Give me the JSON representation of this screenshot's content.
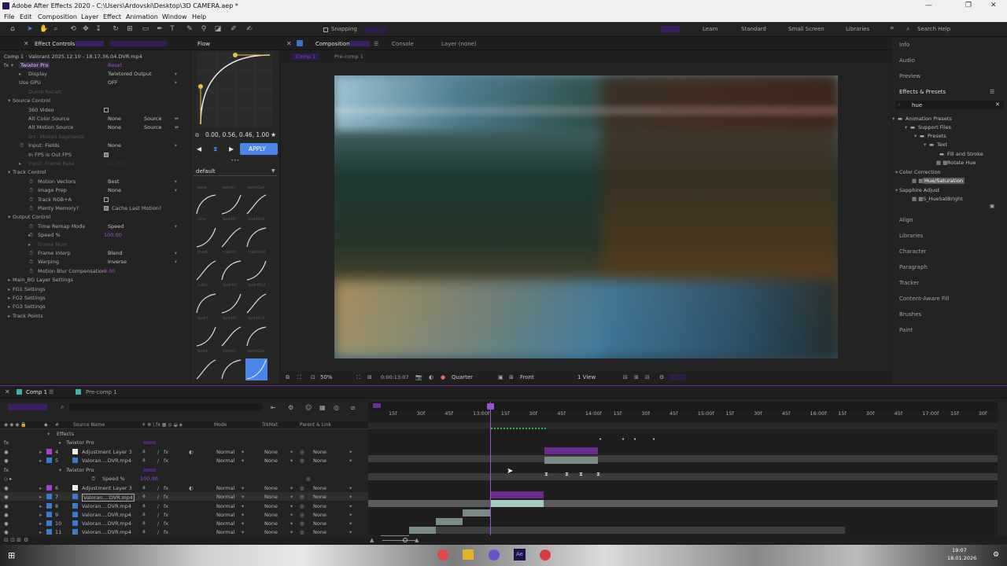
{
  "window": {
    "title": "Adobe After Effects 2020 - C:\\Users\\Ardovski\\Desktop\\3D CAMERA.aep *"
  },
  "menu": [
    "File",
    "Edit",
    "Composition",
    "Layer",
    "Effect",
    "Animation",
    "Window",
    "Help"
  ],
  "toolbar": {
    "snapping": "Snapping",
    "workspaces": [
      "Learn",
      "Standard",
      "Small Screen",
      "Libraries"
    ],
    "search_placeholder": "Search Help"
  },
  "effect_controls": {
    "tab": "Effect Controls",
    "layer": "Comp 1 · Valorant 2025.12.10 - 18.17.36.04.DVR.mp4",
    "plugin": "Twixtor Pro",
    "plugin_sub": "Reset",
    "rows": [
      {
        "label": "Display",
        "value": "Twixtored Output"
      },
      {
        "label": "Use GPU",
        "value": "OFF"
      },
      {
        "label": "Dumb Recalc",
        "value": ""
      },
      {
        "label": "Source Control",
        "value": ""
      },
      {
        "label": "360 Video",
        "value": ""
      },
      {
        "label": "Alt Color Source",
        "value": "None",
        "value2": "Source"
      },
      {
        "label": "Alt Motion Source",
        "value": "None",
        "value2": "Source"
      },
      {
        "label": "Src: Motion Segments",
        "value": ""
      },
      {
        "label": "Input: Fields",
        "value": "None"
      },
      {
        "label": "In FPS is Out FPS",
        "value": ""
      },
      {
        "label": "Input: Frame Rate",
        "value": "120.000"
      },
      {
        "label": "Track Control",
        "value": ""
      },
      {
        "label": "Motion Vectors",
        "value": "Best"
      },
      {
        "label": "Image Prep",
        "value": "None"
      },
      {
        "label": "Track RGB+A",
        "value": ""
      },
      {
        "label": "Plenty Memory?",
        "value": "Cache Last Motion?"
      },
      {
        "label": "Output Control",
        "value": ""
      },
      {
        "label": "Time Remap Mode",
        "value": "Speed"
      },
      {
        "label": "Speed %",
        "value": "100.00"
      },
      {
        "label": "Frame Num",
        "value": "0.00"
      },
      {
        "label": "Frame Interp",
        "value": "Blend"
      },
      {
        "label": "Warping",
        "value": "Inverse"
      },
      {
        "label": "Motion Blur Compensation",
        "value": "0.00"
      },
      {
        "label": "Main_BG Layer Settings",
        "value": ""
      },
      {
        "label": "FG1 Settings",
        "value": ""
      },
      {
        "label": "FG2 Settings",
        "value": ""
      },
      {
        "label": "FG3 Settings",
        "value": ""
      },
      {
        "label": "Track Points",
        "value": ""
      }
    ]
  },
  "flow": {
    "tab": "Flow",
    "bezier": "0.00, 0.56, 0.46, 1.00",
    "apply": "APPLY",
    "preset": "default",
    "curve_labels": [
      "ease",
      "easeIn",
      "easeOut",
      "sine",
      "quadIn",
      "quadOut",
      "quad",
      "cubicIn",
      "cubicOut",
      "cubic",
      "quartIn",
      "quartOut",
      "quart",
      "quintIn",
      "quintOut",
      "quint",
      "expoIn",
      "expoOut"
    ]
  },
  "composition": {
    "tab": "Composition",
    "comp_name": "Comp 1",
    "console": "Console",
    "layer": "Layer (none)",
    "breadcrumbs": [
      "Comp 1",
      "Pre-comp 1"
    ],
    "footer": {
      "zoom": "50%",
      "timecode": "0:00:13:07",
      "quality": "Quarter",
      "view": "Front",
      "views": "1 View"
    }
  },
  "right_panel": {
    "items": [
      "Info",
      "Audio",
      "Preview",
      "Effects & Presets"
    ],
    "search": "hue",
    "tree": [
      "Animation Presets",
      "Support Files",
      "Presets",
      "Text",
      "Fill and Stroke",
      "Rotate Hue",
      "Color Correction",
      "Hue/Saturation",
      "Sapphire Adjust",
      "S_HueSatBright"
    ],
    "lower": [
      "Align",
      "Libraries",
      "Character",
      "Paragraph",
      "Tracker",
      "Content-Aware Fill",
      "Brushes",
      "Paint"
    ]
  },
  "timeline": {
    "tabs": [
      "Comp 1",
      "Pre-comp 1"
    ],
    "timecode": "0:00:13:07",
    "search_placeholder": "",
    "col_headers": {
      "source": "Source Name",
      "mode": "Mode",
      "trkmat": "TrkMat",
      "parent": "Parent & Link"
    },
    "ruler": [
      "15f",
      "30f",
      "45f",
      "13:00f",
      "15f",
      "30f",
      "45f",
      "14:00f",
      "15f",
      "30f",
      "45f",
      "15:00f",
      "15f",
      "30f",
      "45f",
      "16:00f",
      "15f",
      "30f",
      "45f",
      "17:00f",
      "15f",
      "30f"
    ],
    "layers": [
      {
        "num": "",
        "name": "Effects",
        "type": "group"
      },
      {
        "num": "",
        "name": "Twixtor Pro",
        "type": "fx"
      },
      {
        "num": "4",
        "name": "Adjustment Layer 3",
        "mode": "Normal",
        "trk": "None",
        "parent": "None",
        "color": "#a33fd8"
      },
      {
        "num": "5",
        "name": "Valoran....DVR.mp4",
        "mode": "Normal",
        "trk": "None",
        "parent": "None",
        "color": "#3a7ad0"
      },
      {
        "num": "",
        "name": "Twixtor Pro",
        "type": "fx"
      },
      {
        "num": "",
        "name": "Speed %",
        "type": "prop",
        "value": "100.00"
      },
      {
        "num": "6",
        "name": "Adjustment Layer 3",
        "mode": "Normal",
        "trk": "None",
        "parent": "None",
        "color": "#a33fd8"
      },
      {
        "num": "7",
        "name": "Valoran....DVR.mp4",
        "mode": "Normal",
        "trk": "None",
        "parent": "None",
        "color": "#3a7ad0"
      },
      {
        "num": "8",
        "name": "Valoran....DVR.mp4",
        "mode": "Normal",
        "trk": "None",
        "parent": "None",
        "color": "#3a7ad0"
      },
      {
        "num": "9",
        "name": "Valoran....DVR.mp4",
        "mode": "Normal",
        "trk": "None",
        "parent": "None",
        "color": "#3a7ad0"
      },
      {
        "num": "10",
        "name": "Valoran....DVR.mp4",
        "mode": "Normal",
        "trk": "None",
        "parent": "None",
        "color": "#3a7ad0"
      },
      {
        "num": "11",
        "name": "Valoran....DVR.mp4",
        "mode": "Normal",
        "trk": "None",
        "parent": "None",
        "color": "#3a7ad0"
      }
    ]
  },
  "taskbar": {
    "time": "19:07",
    "date": "18.01.2026"
  }
}
